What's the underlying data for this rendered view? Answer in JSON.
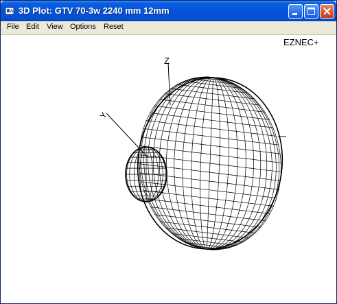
{
  "window": {
    "title": "3D Plot: GTV 70-3w 2240 mm 12mm",
    "title_bar_color": "#0553d9",
    "close_button_color": "#d9542c",
    "app_icon": "chart-app-icon"
  },
  "menu": {
    "items": [
      {
        "label": "File"
      },
      {
        "label": "Edit"
      },
      {
        "label": "View"
      },
      {
        "label": "Options"
      },
      {
        "label": "Reset"
      }
    ]
  },
  "plot": {
    "brand": "EZNEC+",
    "axis_z_label": "Z",
    "axis_y_label": "Y",
    "mesh_color": "#000000",
    "background_color": "#ffffff"
  }
}
